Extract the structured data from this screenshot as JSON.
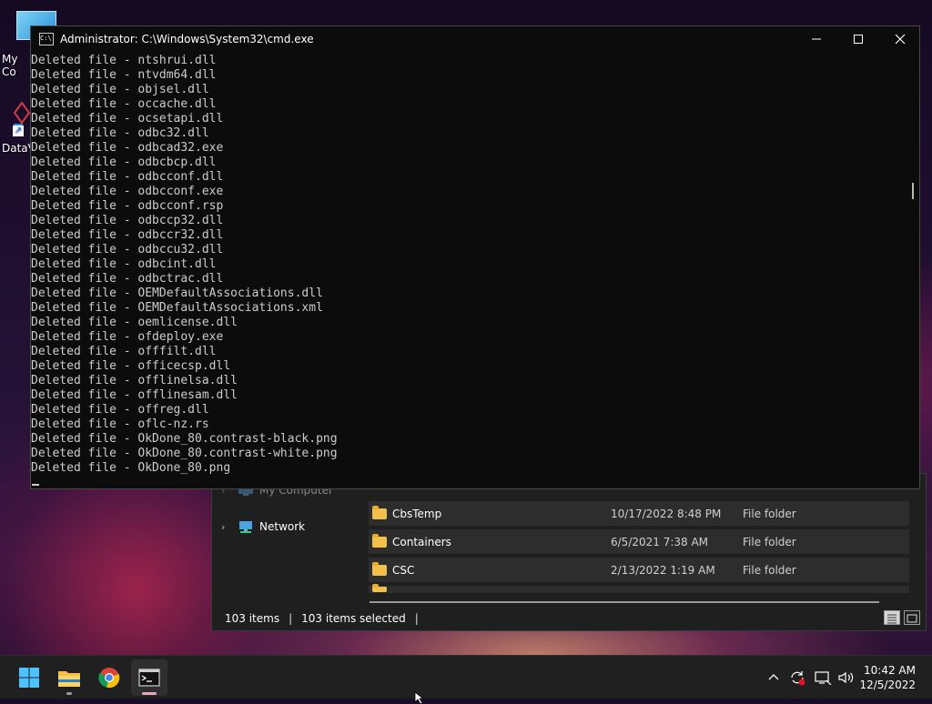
{
  "desktop": {
    "icons": [
      {
        "label": "My Co"
      },
      {
        "label": "DataV"
      }
    ]
  },
  "cmd": {
    "title": "Administrator:  C:\\Windows\\System32\\cmd.exe",
    "lines": [
      "Deleted file - ntshrui.dll",
      "Deleted file - ntvdm64.dll",
      "Deleted file - objsel.dll",
      "Deleted file - occache.dll",
      "Deleted file - ocsetapi.dll",
      "Deleted file - odbc32.dll",
      "Deleted file - odbcad32.exe",
      "Deleted file - odbcbcp.dll",
      "Deleted file - odbcconf.dll",
      "Deleted file - odbcconf.exe",
      "Deleted file - odbcconf.rsp",
      "Deleted file - odbccp32.dll",
      "Deleted file - odbccr32.dll",
      "Deleted file - odbccu32.dll",
      "Deleted file - odbcint.dll",
      "Deleted file - odbctrac.dll",
      "Deleted file - OEMDefaultAssociations.dll",
      "Deleted file - OEMDefaultAssociations.xml",
      "Deleted file - oemlicense.dll",
      "Deleted file - ofdeploy.exe",
      "Deleted file - offfilt.dll",
      "Deleted file - officecsp.dll",
      "Deleted file - offlinelsa.dll",
      "Deleted file - offlinesam.dll",
      "Deleted file - offreg.dll",
      "Deleted file - oflc-nz.rs",
      "Deleted file - OkDone_80.contrast-black.png",
      "Deleted file - OkDone_80.contrast-white.png",
      "Deleted file - OkDone_80.png"
    ]
  },
  "explorer": {
    "nav": [
      {
        "label": "My Computer"
      },
      {
        "label": "Network"
      }
    ],
    "rows": [
      {
        "name": "CbsTemp",
        "date": "10/17/2022 8:48 PM",
        "type": "File folder"
      },
      {
        "name": "Containers",
        "date": "6/5/2021 7:38 AM",
        "type": "File folder"
      },
      {
        "name": "CSC",
        "date": "2/13/2022 1:19 AM",
        "type": "File folder"
      }
    ],
    "status": {
      "items": "103 items",
      "selected": "103 items selected"
    }
  },
  "taskbar": {
    "time": "10:42 AM",
    "date": "12/5/2022"
  },
  "colors": {
    "console_bg": "#0c0c0c",
    "console_text": "#cccccc",
    "taskbar_bg": "#202020",
    "folder": "#f3c04a"
  }
}
